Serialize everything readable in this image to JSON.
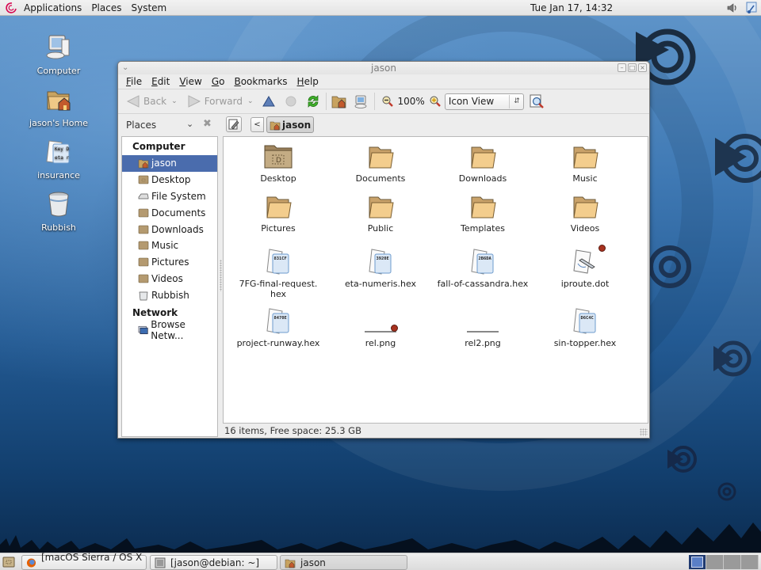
{
  "top_panel": {
    "menus": [
      "Applications",
      "Places",
      "System"
    ],
    "clock": "Tue Jan 17, 14:32",
    "tray_icons": [
      "volume-icon",
      "network-icon"
    ]
  },
  "desktop": {
    "icons": [
      {
        "label": "Computer",
        "icon": "computer-icon"
      },
      {
        "label": "jason's Home",
        "icon": "home-folder-icon"
      },
      {
        "label": "insurance",
        "icon": "text-file-icon"
      },
      {
        "label": "Rubbish",
        "icon": "trash-icon"
      }
    ]
  },
  "window": {
    "title": "jason",
    "menubar": [
      {
        "label": "File",
        "mnemonic": "F",
        "rest": "ile"
      },
      {
        "label": "Edit",
        "mnemonic": "E",
        "rest": "dit"
      },
      {
        "label": "View",
        "mnemonic": "V",
        "rest": "iew"
      },
      {
        "label": "Go",
        "mnemonic": "G",
        "rest": "o"
      },
      {
        "label": "Bookmarks",
        "mnemonic": "B",
        "rest": "ookmarks"
      },
      {
        "label": "Help",
        "mnemonic": "H",
        "rest": "elp"
      }
    ],
    "toolbar": {
      "back_label": "Back",
      "forward_label": "Forward",
      "zoom_level": "100%",
      "view_mode": "Icon View"
    },
    "location": {
      "places_label": "Places",
      "crumb": "jason"
    },
    "sidebar": {
      "sections": [
        {
          "header": "Computer",
          "items": [
            {
              "label": "jason",
              "icon": "home-icon",
              "selected": true
            },
            {
              "label": "Desktop",
              "icon": "desktop-folder-icon"
            },
            {
              "label": "File System",
              "icon": "drive-icon"
            },
            {
              "label": "Documents",
              "icon": "folder-icon"
            },
            {
              "label": "Downloads",
              "icon": "folder-icon"
            },
            {
              "label": "Music",
              "icon": "folder-icon"
            },
            {
              "label": "Pictures",
              "icon": "folder-icon"
            },
            {
              "label": "Videos",
              "icon": "folder-icon"
            },
            {
              "label": "Rubbish",
              "icon": "trash-icon"
            }
          ]
        },
        {
          "header": "Network",
          "items": [
            {
              "label": "Browse Netw...",
              "icon": "network-icon"
            }
          ]
        }
      ]
    },
    "files": [
      {
        "name": "Desktop",
        "type": "desktop-folder"
      },
      {
        "name": "Documents",
        "type": "folder"
      },
      {
        "name": "Downloads",
        "type": "folder"
      },
      {
        "name": "Music",
        "type": "folder"
      },
      {
        "name": "Pictures",
        "type": "folder"
      },
      {
        "name": "Public",
        "type": "folder"
      },
      {
        "name": "Templates",
        "type": "folder"
      },
      {
        "name": "Videos",
        "type": "folder"
      },
      {
        "name": "7FG-final-request.\nhex",
        "type": "hex",
        "preview": "831CF"
      },
      {
        "name": "eta-numeris.hex",
        "type": "hex",
        "preview": "3920E"
      },
      {
        "name": "fall-of-cassandra.hex",
        "type": "hex",
        "preview": "2B6DA"
      },
      {
        "name": "iproute.dot",
        "type": "dot",
        "emblem": true
      },
      {
        "name": "project-runway.hex",
        "type": "hex",
        "preview": "8470E"
      },
      {
        "name": "rel.png",
        "type": "png",
        "emblem": true
      },
      {
        "name": "rel2.png",
        "type": "png"
      },
      {
        "name": "sin-topper.hex",
        "type": "hex",
        "preview": "D6C4C"
      }
    ],
    "status": "16 items, Free space: 25.3 GB"
  },
  "taskbar": {
    "tasks": [
      {
        "label": "[macOS Sierra / OS X ...",
        "icon": "firefox-icon"
      },
      {
        "label": "[jason@debian: ~]",
        "icon": "terminal-icon"
      },
      {
        "label": "jason",
        "icon": "home-folder-icon",
        "active": true
      }
    ],
    "workspaces": 4,
    "current_workspace": 1
  }
}
